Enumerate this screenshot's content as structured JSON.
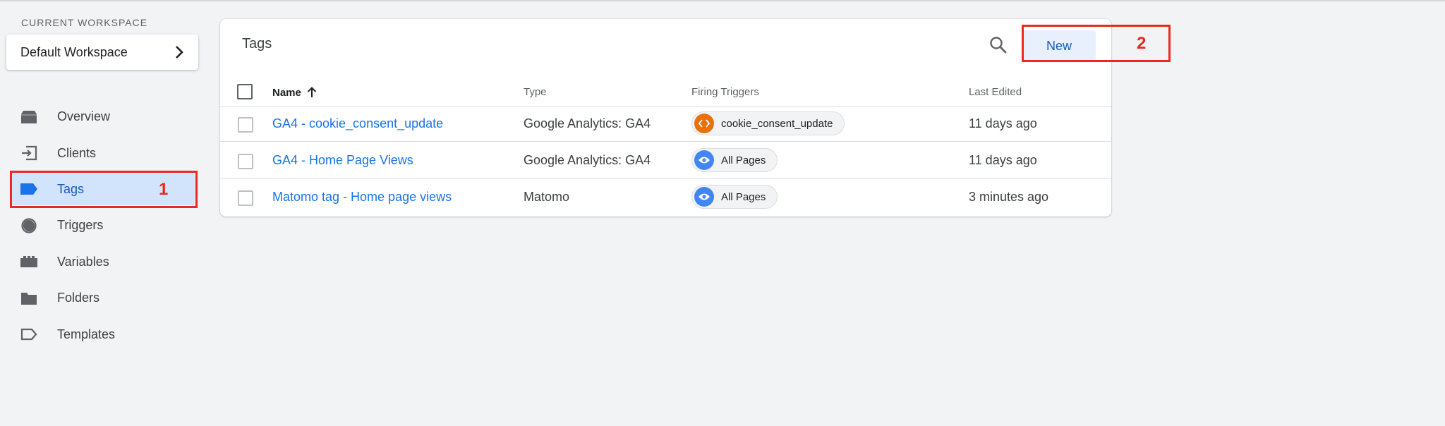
{
  "sidebar": {
    "workspace_label": "CURRENT WORKSPACE",
    "workspace_name": "Default Workspace",
    "items": [
      {
        "label": "Overview",
        "icon": "overview-icon"
      },
      {
        "label": "Clients",
        "icon": "clients-icon"
      },
      {
        "label": "Tags",
        "icon": "tag-icon",
        "active": true
      },
      {
        "label": "Triggers",
        "icon": "trigger-icon"
      },
      {
        "label": "Variables",
        "icon": "variables-icon"
      },
      {
        "label": "Folders",
        "icon": "folder-icon"
      },
      {
        "label": "Templates",
        "icon": "template-icon"
      }
    ]
  },
  "annotations": {
    "first": "1",
    "second": "2",
    "color": "#ea2a1e"
  },
  "main": {
    "title": "Tags",
    "new_label": "New",
    "columns": {
      "name": "Name",
      "type": "Type",
      "triggers": "Firing Triggers",
      "edited": "Last Edited"
    },
    "rows": [
      {
        "name": "GA4 - cookie_consent_update",
        "type": "Google Analytics: GA4",
        "trigger": "cookie_consent_update",
        "trigger_icon": "code-icon",
        "trigger_color": "#e8710a",
        "edited": "11 days ago"
      },
      {
        "name": "GA4 - Home Page Views",
        "type": "Google Analytics: GA4",
        "trigger": "All Pages",
        "trigger_icon": "eye-icon",
        "trigger_color": "#4285f4",
        "edited": "11 days ago"
      },
      {
        "name": "Matomo tag - Home page views",
        "type": "Matomo",
        "trigger": "All Pages",
        "trigger_icon": "eye-icon",
        "trigger_color": "#4285f4",
        "edited": "3 minutes ago"
      }
    ]
  },
  "colors": {
    "accent": "#1a73e8",
    "active_bg": "#d2e3fc",
    "background": "#f1f3f4"
  }
}
